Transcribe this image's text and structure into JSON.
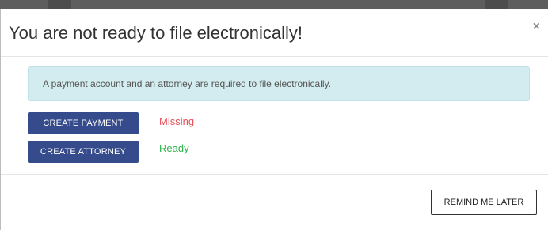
{
  "dialog": {
    "title": "You are not ready to file electronically!",
    "close_symbol": "×"
  },
  "body": {
    "alert_text": "A payment account and an attorney are required to file electronically.",
    "requirements": [
      {
        "button_label": "CREATE PAYMENT",
        "status": "Missing",
        "status_color": "#e8505b"
      },
      {
        "button_label": "CREATE ATTORNEY",
        "status": "Ready",
        "status_color": "#2fb34b"
      }
    ]
  },
  "footer": {
    "remind_label": "REMIND ME LATER"
  },
  "colors": {
    "primary_button": "#354b8c",
    "alert_background": "#d2ecf0"
  }
}
